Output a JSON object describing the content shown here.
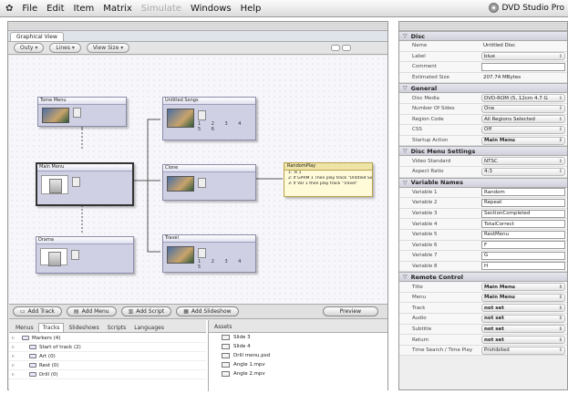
{
  "menubar": {
    "apple": "✿",
    "items": [
      "File",
      "Edit",
      "Item",
      "Matrix",
      "Simulate",
      "Windows",
      "Help"
    ],
    "dim_index": 4,
    "app_name": "DVD Studio Pro"
  },
  "graphical_view": {
    "tab_label": "Graphical View",
    "toolbar": {
      "popup1": "Outy",
      "popup2": "Lines",
      "popup3": "View Size"
    },
    "tiles": [
      {
        "key": "tome",
        "title": "Tome Menu",
        "kind": "menu"
      },
      {
        "key": "untitled",
        "title": "Untitled Songs",
        "kind": "track",
        "nums": "1 2 3 4 5 6"
      },
      {
        "key": "main",
        "title": "Main Menu",
        "kind": "menu"
      },
      {
        "key": "clone",
        "title": "Clone",
        "kind": "track"
      },
      {
        "key": "drama",
        "title": "Drama",
        "kind": "menu"
      },
      {
        "key": "travel",
        "title": "Travel",
        "kind": "track",
        "nums": "1 2 3 4 5"
      }
    ],
    "script": {
      "title": "RandomPlay",
      "lines": [
        "1: Ts 1",
        "2: If GPRM 1 Then play track \"Untitled Songs\"",
        "3: If Var 1 then play track \"Travel\""
      ]
    }
  },
  "add_bar": {
    "buttons": [
      "Add Track",
      "Add Menu",
      "Add Script",
      "Add Slideshow"
    ],
    "preview": "Preview"
  },
  "project_tabs": [
    "Menus",
    "Tracks",
    "Slideshows",
    "Scripts",
    "Languages"
  ],
  "project_tabs_selected": 1,
  "tree": [
    {
      "label": "Markers (4)",
      "expandable": true
    },
    {
      "label": "Start of track (2)",
      "expandable": true
    },
    {
      "label": "Art (0)",
      "expandable": true
    },
    {
      "label": "Rest (0)",
      "expandable": true
    },
    {
      "label": "Drill (0)",
      "expandable": true
    }
  ],
  "assets": {
    "header": "Assets",
    "items": [
      "Slide 3",
      "Slide 4",
      "Drill menu.psd",
      "Angle 1.mpv",
      "Angle 2.mpv"
    ]
  },
  "inspector": {
    "sections": [
      {
        "title": "Disc",
        "rows": [
          {
            "label": "Name",
            "value": "Untitled Disc",
            "style": "plain"
          },
          {
            "label": "Label",
            "value": "blue",
            "style": "popup"
          },
          {
            "label": "Comment",
            "value": "",
            "style": "field"
          },
          {
            "label": "Estimated Size",
            "value": "207.74 MBytes",
            "style": "plain"
          }
        ]
      },
      {
        "title": "General",
        "rows": [
          {
            "label": "Disc Media",
            "value": "DVD-ROM (5, 12cm 4.7 G",
            "style": "popup"
          },
          {
            "label": "Number Of Sides",
            "value": "One",
            "style": "popup"
          },
          {
            "label": "Region Code",
            "value": "All Regions Selected",
            "style": "popup"
          },
          {
            "label": "CSS",
            "value": "Off",
            "style": "popup"
          },
          {
            "label": "Startup Action",
            "value": "Main Menu",
            "style": "popup-bold"
          }
        ]
      },
      {
        "title": "Disc Menu Settings",
        "rows": [
          {
            "label": "Video Standard",
            "value": "NTSC",
            "style": "popup"
          },
          {
            "label": "Aspect Ratio",
            "value": "4:3",
            "style": "popup"
          }
        ]
      },
      {
        "title": "Variable Names",
        "rows": [
          {
            "label": "Variable 1",
            "value": "Random",
            "style": "field"
          },
          {
            "label": "Variable 2",
            "value": "Repeat",
            "style": "field"
          },
          {
            "label": "Variable 3",
            "value": "SectionCompleted",
            "style": "field"
          },
          {
            "label": "Variable 4",
            "value": "TotalCorrect",
            "style": "field"
          },
          {
            "label": "Variable 5",
            "value": "RestMenu",
            "style": "field"
          },
          {
            "label": "Variable 6",
            "value": "F",
            "style": "field"
          },
          {
            "label": "Variable 7",
            "value": "G",
            "style": "field"
          },
          {
            "label": "Variable 8",
            "value": "H",
            "style": "field"
          }
        ]
      },
      {
        "title": "Remote Control",
        "rows": [
          {
            "label": "Title",
            "value": "Main Menu",
            "style": "popup-bold"
          },
          {
            "label": "Menu",
            "value": "Main Menu",
            "style": "popup-bold"
          },
          {
            "label": "Track",
            "value": "not set",
            "style": "popup-bold"
          },
          {
            "label": "Audio",
            "value": "not set",
            "style": "popup-bold"
          },
          {
            "label": "Subtitle",
            "value": "not set",
            "style": "popup-bold"
          },
          {
            "label": "Return",
            "value": "not set",
            "style": "popup-bold"
          },
          {
            "label": "Time Search / Time Play",
            "value": "Prohibited",
            "style": "popup"
          }
        ]
      }
    ]
  }
}
